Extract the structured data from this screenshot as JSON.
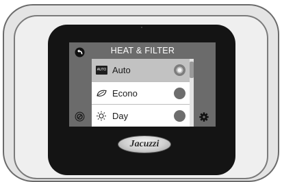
{
  "screen": {
    "title": "HEAT & FILTER",
    "options": [
      {
        "label": "Auto",
        "icon": "auto-icon",
        "icon_text": "AUTO",
        "selected": true
      },
      {
        "label": "Econo",
        "icon": "leaf-icon",
        "selected": false
      },
      {
        "label": "Day",
        "icon": "sun-icon",
        "selected": false
      }
    ],
    "left_controls": [
      "back-arrow-icon",
      "ban-icon"
    ],
    "right_controls": [
      "gear-icon"
    ]
  },
  "brand": {
    "logo_text": "Jacuzzi"
  },
  "colors": {
    "panel": "#6b6b6b",
    "selected_row": "#c2c2c2",
    "row": "#ffffff",
    "bezel": "#141414"
  }
}
